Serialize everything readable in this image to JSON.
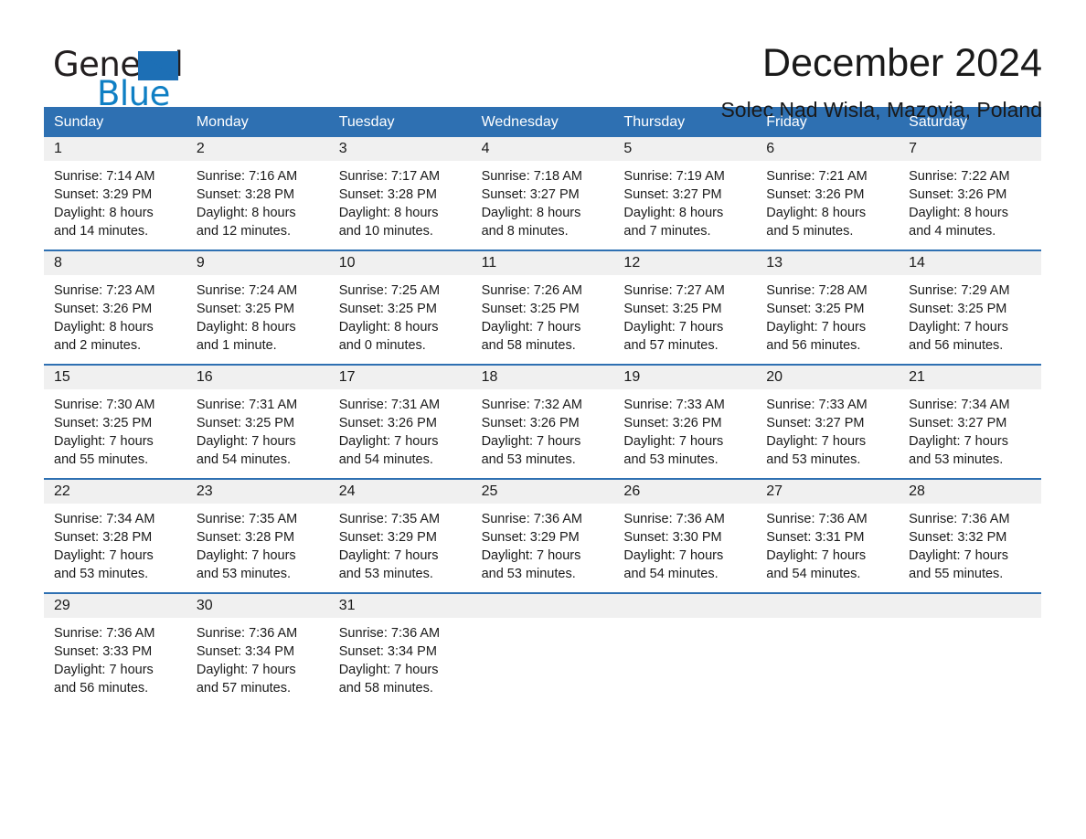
{
  "brand": {
    "word_one": "General",
    "word_two": "Blue",
    "triangle_icon": "triangle-logo-icon"
  },
  "header": {
    "month_title": "December 2024",
    "location": "Solec Nad Wisla, Mazovia, Poland"
  },
  "colors": {
    "header_blue": "#2e70b2",
    "day_band_gray": "#f0f0f0",
    "brand_blue": "#0f7fc4",
    "text": "#1a1a1a"
  },
  "calendar": {
    "weekdays": [
      "Sunday",
      "Monday",
      "Tuesday",
      "Wednesday",
      "Thursday",
      "Friday",
      "Saturday"
    ],
    "weeks": [
      [
        {
          "day": "1",
          "sunrise": "Sunrise: 7:14 AM",
          "sunset": "Sunset: 3:29 PM",
          "daylight_1": "Daylight: 8 hours",
          "daylight_2": "and 14 minutes."
        },
        {
          "day": "2",
          "sunrise": "Sunrise: 7:16 AM",
          "sunset": "Sunset: 3:28 PM",
          "daylight_1": "Daylight: 8 hours",
          "daylight_2": "and 12 minutes."
        },
        {
          "day": "3",
          "sunrise": "Sunrise: 7:17 AM",
          "sunset": "Sunset: 3:28 PM",
          "daylight_1": "Daylight: 8 hours",
          "daylight_2": "and 10 minutes."
        },
        {
          "day": "4",
          "sunrise": "Sunrise: 7:18 AM",
          "sunset": "Sunset: 3:27 PM",
          "daylight_1": "Daylight: 8 hours",
          "daylight_2": "and 8 minutes."
        },
        {
          "day": "5",
          "sunrise": "Sunrise: 7:19 AM",
          "sunset": "Sunset: 3:27 PM",
          "daylight_1": "Daylight: 8 hours",
          "daylight_2": "and 7 minutes."
        },
        {
          "day": "6",
          "sunrise": "Sunrise: 7:21 AM",
          "sunset": "Sunset: 3:26 PM",
          "daylight_1": "Daylight: 8 hours",
          "daylight_2": "and 5 minutes."
        },
        {
          "day": "7",
          "sunrise": "Sunrise: 7:22 AM",
          "sunset": "Sunset: 3:26 PM",
          "daylight_1": "Daylight: 8 hours",
          "daylight_2": "and 4 minutes."
        }
      ],
      [
        {
          "day": "8",
          "sunrise": "Sunrise: 7:23 AM",
          "sunset": "Sunset: 3:26 PM",
          "daylight_1": "Daylight: 8 hours",
          "daylight_2": "and 2 minutes."
        },
        {
          "day": "9",
          "sunrise": "Sunrise: 7:24 AM",
          "sunset": "Sunset: 3:25 PM",
          "daylight_1": "Daylight: 8 hours",
          "daylight_2": "and 1 minute."
        },
        {
          "day": "10",
          "sunrise": "Sunrise: 7:25 AM",
          "sunset": "Sunset: 3:25 PM",
          "daylight_1": "Daylight: 8 hours",
          "daylight_2": "and 0 minutes."
        },
        {
          "day": "11",
          "sunrise": "Sunrise: 7:26 AM",
          "sunset": "Sunset: 3:25 PM",
          "daylight_1": "Daylight: 7 hours",
          "daylight_2": "and 58 minutes."
        },
        {
          "day": "12",
          "sunrise": "Sunrise: 7:27 AM",
          "sunset": "Sunset: 3:25 PM",
          "daylight_1": "Daylight: 7 hours",
          "daylight_2": "and 57 minutes."
        },
        {
          "day": "13",
          "sunrise": "Sunrise: 7:28 AM",
          "sunset": "Sunset: 3:25 PM",
          "daylight_1": "Daylight: 7 hours",
          "daylight_2": "and 56 minutes."
        },
        {
          "day": "14",
          "sunrise": "Sunrise: 7:29 AM",
          "sunset": "Sunset: 3:25 PM",
          "daylight_1": "Daylight: 7 hours",
          "daylight_2": "and 56 minutes."
        }
      ],
      [
        {
          "day": "15",
          "sunrise": "Sunrise: 7:30 AM",
          "sunset": "Sunset: 3:25 PM",
          "daylight_1": "Daylight: 7 hours",
          "daylight_2": "and 55 minutes."
        },
        {
          "day": "16",
          "sunrise": "Sunrise: 7:31 AM",
          "sunset": "Sunset: 3:25 PM",
          "daylight_1": "Daylight: 7 hours",
          "daylight_2": "and 54 minutes."
        },
        {
          "day": "17",
          "sunrise": "Sunrise: 7:31 AM",
          "sunset": "Sunset: 3:26 PM",
          "daylight_1": "Daylight: 7 hours",
          "daylight_2": "and 54 minutes."
        },
        {
          "day": "18",
          "sunrise": "Sunrise: 7:32 AM",
          "sunset": "Sunset: 3:26 PM",
          "daylight_1": "Daylight: 7 hours",
          "daylight_2": "and 53 minutes."
        },
        {
          "day": "19",
          "sunrise": "Sunrise: 7:33 AM",
          "sunset": "Sunset: 3:26 PM",
          "daylight_1": "Daylight: 7 hours",
          "daylight_2": "and 53 minutes."
        },
        {
          "day": "20",
          "sunrise": "Sunrise: 7:33 AM",
          "sunset": "Sunset: 3:27 PM",
          "daylight_1": "Daylight: 7 hours",
          "daylight_2": "and 53 minutes."
        },
        {
          "day": "21",
          "sunrise": "Sunrise: 7:34 AM",
          "sunset": "Sunset: 3:27 PM",
          "daylight_1": "Daylight: 7 hours",
          "daylight_2": "and 53 minutes."
        }
      ],
      [
        {
          "day": "22",
          "sunrise": "Sunrise: 7:34 AM",
          "sunset": "Sunset: 3:28 PM",
          "daylight_1": "Daylight: 7 hours",
          "daylight_2": "and 53 minutes."
        },
        {
          "day": "23",
          "sunrise": "Sunrise: 7:35 AM",
          "sunset": "Sunset: 3:28 PM",
          "daylight_1": "Daylight: 7 hours",
          "daylight_2": "and 53 minutes."
        },
        {
          "day": "24",
          "sunrise": "Sunrise: 7:35 AM",
          "sunset": "Sunset: 3:29 PM",
          "daylight_1": "Daylight: 7 hours",
          "daylight_2": "and 53 minutes."
        },
        {
          "day": "25",
          "sunrise": "Sunrise: 7:36 AM",
          "sunset": "Sunset: 3:29 PM",
          "daylight_1": "Daylight: 7 hours",
          "daylight_2": "and 53 minutes."
        },
        {
          "day": "26",
          "sunrise": "Sunrise: 7:36 AM",
          "sunset": "Sunset: 3:30 PM",
          "daylight_1": "Daylight: 7 hours",
          "daylight_2": "and 54 minutes."
        },
        {
          "day": "27",
          "sunrise": "Sunrise: 7:36 AM",
          "sunset": "Sunset: 3:31 PM",
          "daylight_1": "Daylight: 7 hours",
          "daylight_2": "and 54 minutes."
        },
        {
          "day": "28",
          "sunrise": "Sunrise: 7:36 AM",
          "sunset": "Sunset: 3:32 PM",
          "daylight_1": "Daylight: 7 hours",
          "daylight_2": "and 55 minutes."
        }
      ],
      [
        {
          "day": "29",
          "sunrise": "Sunrise: 7:36 AM",
          "sunset": "Sunset: 3:33 PM",
          "daylight_1": "Daylight: 7 hours",
          "daylight_2": "and 56 minutes."
        },
        {
          "day": "30",
          "sunrise": "Sunrise: 7:36 AM",
          "sunset": "Sunset: 3:34 PM",
          "daylight_1": "Daylight: 7 hours",
          "daylight_2": "and 57 minutes."
        },
        {
          "day": "31",
          "sunrise": "Sunrise: 7:36 AM",
          "sunset": "Sunset: 3:34 PM",
          "daylight_1": "Daylight: 7 hours",
          "daylight_2": "and 58 minutes."
        },
        {
          "day": "",
          "sunrise": "",
          "sunset": "",
          "daylight_1": "",
          "daylight_2": ""
        },
        {
          "day": "",
          "sunrise": "",
          "sunset": "",
          "daylight_1": "",
          "daylight_2": ""
        },
        {
          "day": "",
          "sunrise": "",
          "sunset": "",
          "daylight_1": "",
          "daylight_2": ""
        },
        {
          "day": "",
          "sunrise": "",
          "sunset": "",
          "daylight_1": "",
          "daylight_2": ""
        }
      ]
    ]
  }
}
